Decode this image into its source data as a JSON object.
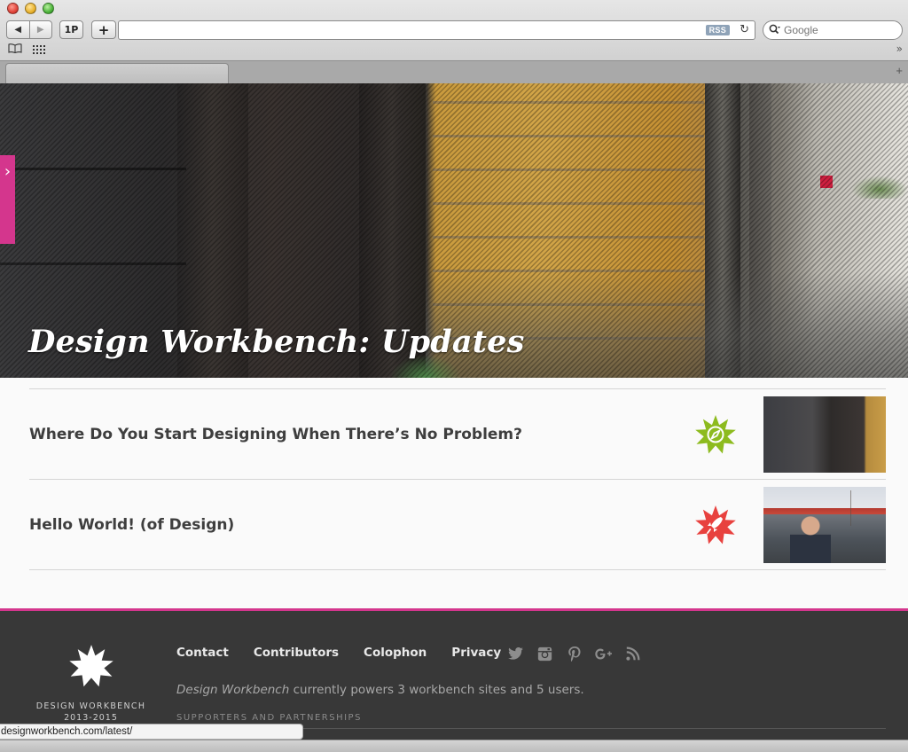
{
  "browser": {
    "nav_back": "◀",
    "nav_forward": "▶",
    "onepassword_label": "1P",
    "add_label": "+",
    "rss_label": "RSS",
    "reload": "↻",
    "search_placeholder": "Google",
    "bookmarks_overflow": "»",
    "new_tab": "+",
    "status_url": "designworkbench.com/latest/"
  },
  "hero": {
    "title": "Design Workbench: Updates",
    "side_toggle": "›"
  },
  "posts": [
    {
      "title": "Where Do You Start Designing When There’s No Problem?",
      "badge_color": "#8dbb1e",
      "badge_icon": "compass-icon"
    },
    {
      "title": "Hello World! (of Design)",
      "badge_color": "#e8413e",
      "badge_icon": "rocket-icon"
    }
  ],
  "footer": {
    "brand_name": "DESIGN WORKBENCH",
    "brand_years": "2013-2015",
    "nav": [
      "Contact",
      "Contributors",
      "Colophon",
      "Privacy"
    ],
    "social": [
      "twitter-icon",
      "instagram-icon",
      "pinterest-icon",
      "google-plus-icon",
      "rss-icon"
    ],
    "tagline_em": "Design Workbench",
    "tagline_rest": " currently powers 3 workbench sites and 5 users.",
    "supporters": "SUPPORTERS AND PARTNERSHIPS"
  },
  "colors": {
    "accent_pink": "#d4368d",
    "footer_bg": "#383838"
  }
}
